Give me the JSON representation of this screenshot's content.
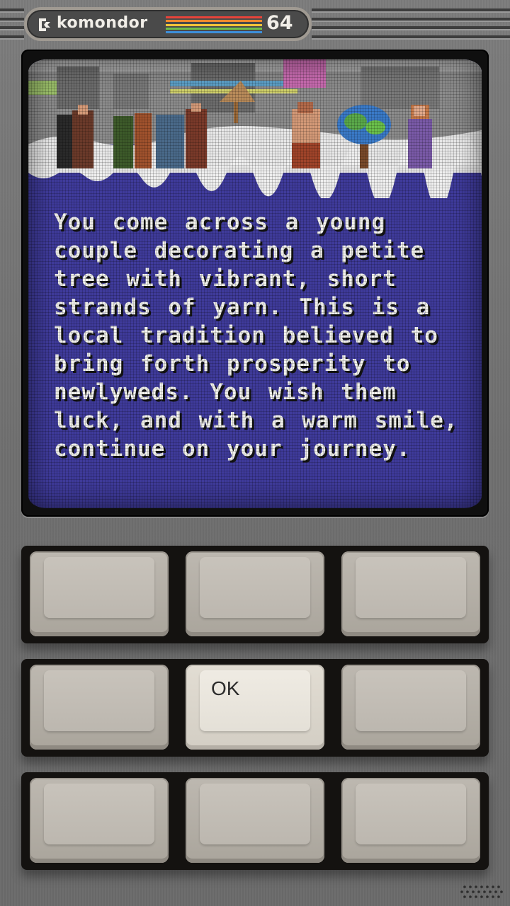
{
  "header": {
    "brand": "komondor",
    "model": "64",
    "stripe_colors": [
      "#e8433a",
      "#f08a2c",
      "#f2c43a",
      "#6fbf4a",
      "#3d8fd9"
    ]
  },
  "screen": {
    "story_text": "You come across a young couple decorating a petite tree with vibrant, short strands of yarn. This is a local tradition believed to bring forth prosperity to newlyweds. You wish them luck, and with a warm smile, continue on your journey.",
    "background_color": "#3f3b9b"
  },
  "keypad": {
    "rows": [
      {
        "keys": [
          {
            "label": ""
          },
          {
            "label": ""
          },
          {
            "label": ""
          }
        ]
      },
      {
        "keys": [
          {
            "label": ""
          },
          {
            "label": "OK"
          },
          {
            "label": ""
          }
        ]
      },
      {
        "keys": [
          {
            "label": ""
          },
          {
            "label": ""
          },
          {
            "label": ""
          }
        ]
      }
    ]
  }
}
